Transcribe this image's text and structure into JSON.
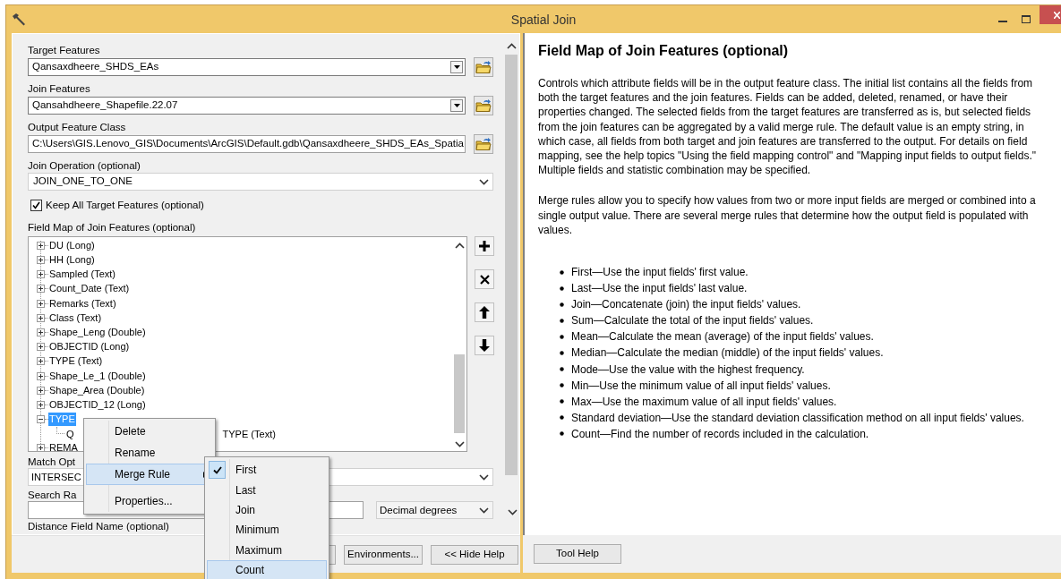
{
  "window": {
    "title": "Spatial Join"
  },
  "inputs": [
    {
      "kind": "combo_browse",
      "label": "Target Features",
      "value": "Qansaxdheere_SHDS_EAs"
    },
    {
      "kind": "combo_browse",
      "label": "Join Features",
      "value": "Qansahdheere_Shapefile.22.07"
    },
    {
      "kind": "text_browse",
      "label": "Output Feature Class",
      "value": "C:\\Users\\GIS.Lenovo_GIS\\Documents\\ArcGIS\\Default.gdb\\Qansaxdheere_SHDS_EAs_Spatia"
    },
    {
      "kind": "dropdown",
      "label": "Join Operation (optional)",
      "value": "JOIN_ONE_TO_ONE"
    },
    {
      "kind": "checkbox",
      "label": "Keep All Target Features (optional)",
      "checked": true
    }
  ],
  "field_map": {
    "label": "Field Map of Join Features (optional)",
    "items": [
      {
        "label": "DU (Long)",
        "expanded": false,
        "selected": false
      },
      {
        "label": "HH (Long)",
        "expanded": false,
        "selected": false
      },
      {
        "label": "Sampled (Text)",
        "expanded": false,
        "selected": false
      },
      {
        "label": "Count_Date (Text)",
        "expanded": false,
        "selected": false
      },
      {
        "label": "Remarks (Text)",
        "expanded": false,
        "selected": false
      },
      {
        "label": "Class (Text)",
        "expanded": false,
        "selected": false
      },
      {
        "label": "Shape_Leng (Double)",
        "expanded": false,
        "selected": false
      },
      {
        "label": "OBJECTID (Long)",
        "expanded": false,
        "selected": false
      },
      {
        "label": "TYPE (Text)",
        "expanded": false,
        "selected": false
      },
      {
        "label": "Shape_Le_1 (Double)",
        "expanded": false,
        "selected": false
      },
      {
        "label": "Shape_Area (Double)",
        "expanded": false,
        "selected": false
      },
      {
        "label": "OBJECTID_12 (Long)",
        "expanded": false,
        "selected": false
      },
      {
        "label": "TYPE",
        "expanded": true,
        "selected": true,
        "children": [
          {
            "text_start": "Q",
            "text_end": "TYPE (Text)"
          }
        ]
      },
      {
        "label": "REMA",
        "expanded": false,
        "selected": false
      }
    ]
  },
  "match_option": {
    "label": "Match Opt",
    "value": "INTERSEC"
  },
  "search_radius": {
    "label": "Search Ra",
    "unit": "Decimal degrees"
  },
  "distance_field": {
    "label": "Distance Field Name (optional)"
  },
  "buttons": [
    "Environments...",
    "<< Hide Help"
  ],
  "context_menu": {
    "items": [
      {
        "label": "Delete",
        "submenu": false,
        "selected": false
      },
      {
        "label": "Rename",
        "submenu": false,
        "selected": false
      },
      {
        "label": "Merge Rule",
        "submenu": true,
        "selected": true
      },
      {
        "label": "Properties...",
        "submenu": false,
        "selected": false
      }
    ]
  },
  "merge_rule_menu": {
    "items": [
      {
        "label": "First",
        "checked": true,
        "selected": false
      },
      {
        "label": "Last",
        "checked": false,
        "selected": false
      },
      {
        "label": "Join",
        "checked": false,
        "selected": false
      },
      {
        "label": "Minimum",
        "checked": false,
        "selected": false
      },
      {
        "label": "Maximum",
        "checked": false,
        "selected": false
      },
      {
        "label": "Count",
        "checked": false,
        "selected": true
      }
    ]
  },
  "help": {
    "title": "Field Map of Join Features (optional)",
    "paragraphs": [
      "Controls which attribute fields will be in the output feature class. The initial list contains all the fields from both the target features and the join features. Fields can be added, deleted, renamed, or have their properties changed. The selected fields from the target features are transferred as is, but selected fields from the join features can be aggregated by a valid merge rule. The default value is an empty string, in which case, all fields from both target and join features are transferred to the output. For details on field mapping, see the help topics \"Using the field mapping control\" and \"Mapping input fields to output fields.\" Multiple fields and statistic combination may be specified.",
      "Merge rules allow you to specify how values from two or more input fields are merged or combined into a single output value. There are several merge rules that determine how the output field is populated with values."
    ],
    "bullets": [
      "First—Use the input fields' first value.",
      "Last—Use the input fields' last value.",
      "Join—Concatenate (join) the input fields' values.",
      "Sum—Calculate the total of the input fields' values.",
      "Mean—Calculate the mean (average) of the input fields' values.",
      "Median—Calculate the median (middle) of the input fields' values.",
      "Mode—Use the value with the highest frequency.",
      "Min—Use the minimum value of all input fields' values.",
      "Max—Use the maximum value of all input fields' values.",
      "Standard deviation—Use the standard deviation classification method on all input fields' values.",
      "Count—Find the number of records included in the calculation."
    ],
    "button": "Tool Help"
  }
}
